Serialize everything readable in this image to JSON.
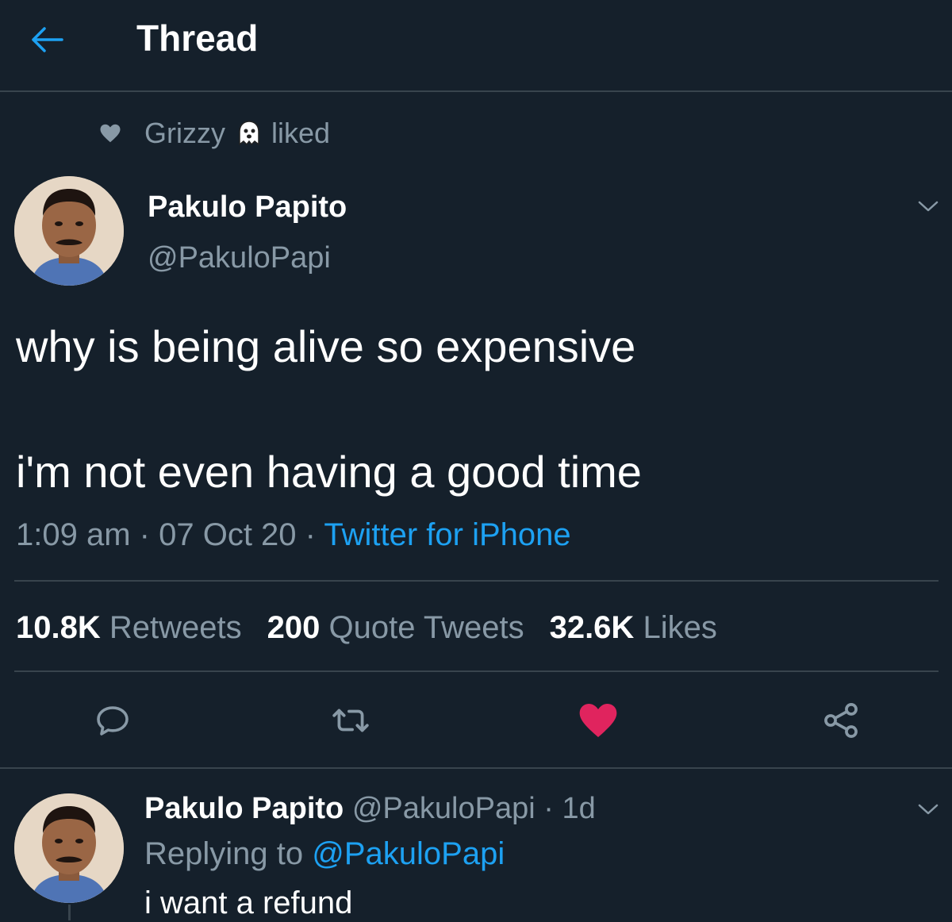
{
  "header": {
    "title": "Thread"
  },
  "social_context": {
    "user": "Grizzy",
    "action": "liked"
  },
  "tweet": {
    "author_name": "Pakulo Papito",
    "author_handle": "@PakuloPapi",
    "text_line1": "why is being alive so expensive",
    "text_line2": "i'm not even having a good time",
    "time": "1:09 am",
    "date": "07 Oct 20",
    "separator": "·",
    "source": "Twitter for iPhone",
    "stats": {
      "retweets_count": "10.8K",
      "retweets_label": "Retweets",
      "quotes_count": "200",
      "quotes_label": "Quote Tweets",
      "likes_count": "32.6K",
      "likes_label": "Likes"
    }
  },
  "reply": {
    "author_name": "Pakulo Papito",
    "author_handle": "@PakuloPapi",
    "age": "1d",
    "replying_label": "Replying to",
    "replying_to": "@PakuloPapi",
    "text": "i want a refund"
  },
  "colors": {
    "background": "#15202b",
    "accent": "#1da1f2",
    "like": "#e0245e",
    "secondary_text": "#8899a6",
    "divider": "#38444d"
  },
  "icons": {
    "back": "arrow-left-icon",
    "liked": "heart-icon",
    "emoji": "ghost-icon",
    "caret": "chevron-down-icon",
    "reply": "reply-icon",
    "retweet": "retweet-icon",
    "like": "heart-filled-icon",
    "share": "share-icon"
  }
}
